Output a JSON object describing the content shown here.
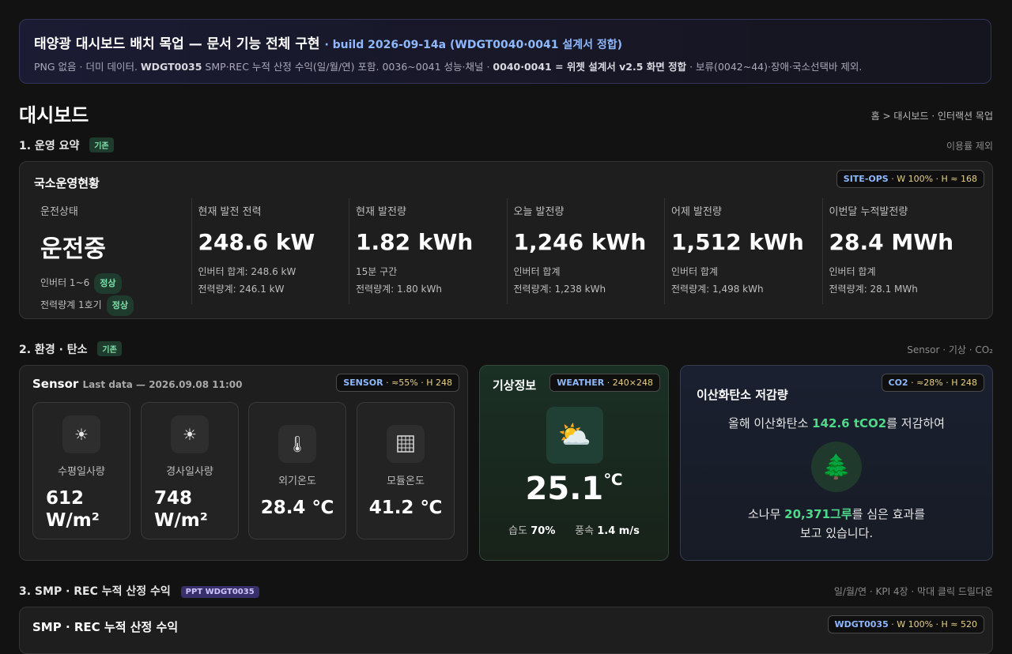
{
  "banner": {
    "title": "태양광 대시보드 배치 목업 — 문서 기능 전체 구현",
    "build": "· build 2026-09-14a (WDGT0040·0041 설계서 정합)",
    "desc_a": "PNG 없음 · 더미 데이터. ",
    "desc_b": "WDGT0035",
    "desc_c": " SMP·REC 누적 산정 수익(일/월/연) 포함. 0036~0041 성능·채널 · ",
    "desc_d": "0040·0041 = 위젯 설계서 v2.5 화면 정합",
    "desc_e": " · 보류(0042~44)·장애·국소선택바 제외."
  },
  "page": {
    "title": "대시보드",
    "breadcrumb": "홈 > 대시보드 · 인터랙션 목업"
  },
  "sections": {
    "s1": {
      "title": "1. 운영 요약",
      "badge": "기존",
      "note": "이용률 제외"
    },
    "s2": {
      "title": "2. 환경 · 탄소",
      "badge": "기존",
      "note": "Sensor · 기상 · CO₂"
    },
    "s3": {
      "title": "3. SMP · REC 누적 산정 수익",
      "badge": "PPT WDGT0035",
      "note": "일/월/연 · KPI 4장 · 막대 클릭 드릴다운"
    }
  },
  "ops": {
    "title": "국소운영현황",
    "tag_key": "SITE-OPS",
    "tag_rest": " · W 100% · H ≈ 168",
    "status": {
      "label": "운전상태",
      "value": "운전중",
      "rows": [
        {
          "label": "인버터 1~6",
          "badge": "정상"
        },
        {
          "label": "전력량계 1호기",
          "badge": "정상"
        }
      ]
    },
    "cols": [
      {
        "label": "현재 발전 전력",
        "value": "248.6 kW",
        "sub1": "인버터 합계: 248.6 kW",
        "sub2": "전력량계: 246.1 kW"
      },
      {
        "label": "현재 발전량",
        "value": "1.82 kWh",
        "sub1": "15분 구간",
        "sub2": "전력량계: 1.80 kWh"
      },
      {
        "label": "오늘 발전량",
        "value": "1,246 kWh",
        "sub1": "인버터 합계",
        "sub2": "전력량계: 1,238 kWh"
      },
      {
        "label": "어제 발전량",
        "value": "1,512 kWh",
        "sub1": "인버터 합계",
        "sub2": "전력량계: 1,498 kWh"
      },
      {
        "label": "이번달 누적발전량",
        "value": "28.4 MWh",
        "sub1": "인버터 합계",
        "sub2": "전력량계: 28.1 MWh"
      }
    ]
  },
  "sensor": {
    "title": "Sensor",
    "last": "Last data — 2026.09.08 11:00",
    "tag_key": "SENSOR",
    "tag_rest": " · ≈55% · H 248",
    "items": [
      {
        "icon": "sun-icon",
        "label": "수평일사량",
        "value": "612 W/m²"
      },
      {
        "icon": "sun-icon",
        "label": "경사일사량",
        "value": "748 W/m²"
      },
      {
        "icon": "thermometer-icon",
        "label": "외기온도",
        "value": "28.4 ℃"
      },
      {
        "icon": "solar-panel-icon",
        "label": "모듈온도",
        "value": "41.2 ℃"
      }
    ]
  },
  "weather": {
    "title": "기상정보",
    "tag_key": "WEATHER",
    "tag_rest": " · 240×248",
    "icon": "partly-cloudy-icon",
    "temp": "25.1",
    "unit": "℃",
    "humidity_label": "습도",
    "humidity": "70%",
    "wind_label": "풍속",
    "wind": "1.4 m/s"
  },
  "co2": {
    "title": "이산화탄소 저감량",
    "tag_key": "CO2",
    "tag_rest": " · ≈28% · H 248",
    "line1_a": "올해 이산화탄소 ",
    "line1_b": "142.6 tCO2",
    "line1_c": "를 저감하여",
    "line2_a": "소나무 ",
    "line2_b": "20,371그루",
    "line2_c": "를 심은 효과를",
    "line3": "보고 있습니다."
  },
  "smp": {
    "title": "SMP · REC 누적 산정 수익",
    "tag_key": "WDGT0035",
    "tag_rest": " · W 100% · H ≈ 520"
  }
}
